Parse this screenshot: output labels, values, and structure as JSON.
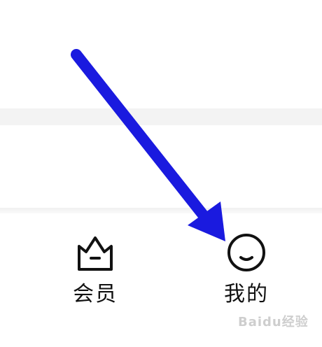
{
  "tabbar": {
    "items": [
      {
        "label": "会员",
        "icon": "crown-icon"
      },
      {
        "label": "我的",
        "icon": "smiley-icon"
      }
    ]
  },
  "annotation": {
    "arrow_color": "#1a1adf"
  },
  "watermark": {
    "text": "Baidu经验"
  }
}
